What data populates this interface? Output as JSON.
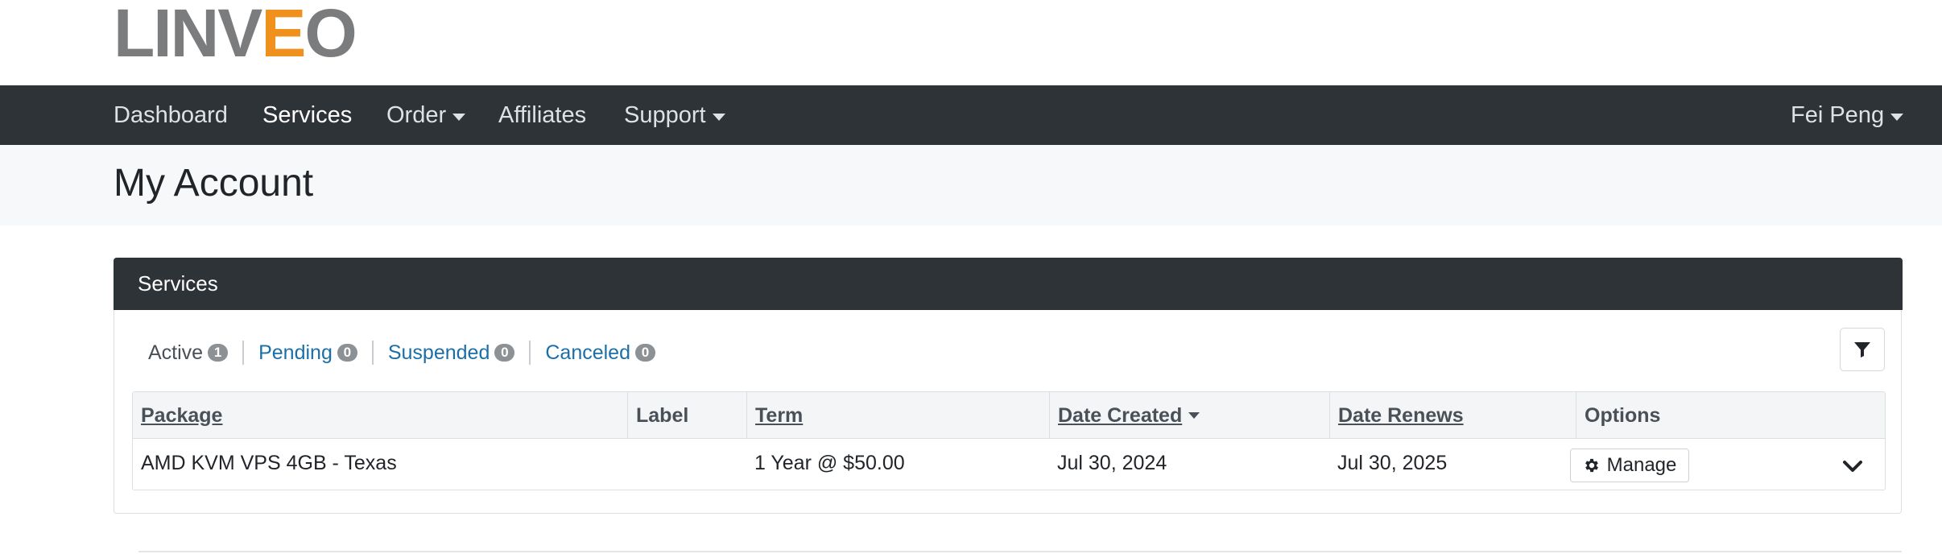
{
  "logo": {
    "text_a": "LINV",
    "text_e": "E",
    "text_o": "O"
  },
  "nav": {
    "items": [
      {
        "label": "Dashboard",
        "dropdown": false
      },
      {
        "label": "Services",
        "dropdown": false
      },
      {
        "label": "Order",
        "dropdown": true
      },
      {
        "label": "Affiliates",
        "dropdown": false
      },
      {
        "label": "Support",
        "dropdown": true
      }
    ],
    "user": "Fei Peng"
  },
  "page": {
    "title": "My Account"
  },
  "card": {
    "title": "Services",
    "filters": [
      {
        "label": "Active",
        "count": "1"
      },
      {
        "label": "Pending",
        "count": "0"
      },
      {
        "label": "Suspended",
        "count": "0"
      },
      {
        "label": "Canceled",
        "count": "0"
      }
    ],
    "table": {
      "columns": [
        "Package",
        "Label",
        "Term",
        "Date Created",
        "Date Renews",
        "Options"
      ],
      "rows": [
        {
          "package": "AMD KVM VPS 4GB - Texas",
          "label": "",
          "term": "1 Year @ $50.00",
          "date_created": "Jul 30, 2024",
          "date_renews": "Jul 30, 2025",
          "manage_label": "Manage"
        }
      ]
    }
  },
  "colors": {
    "navbar_bg": "#2e3338",
    "logo_gray": "#7b7c7e",
    "logo_orange": "#f0911d",
    "link_blue": "#1b6fa8",
    "badge_gray": "#8c9195"
  },
  "icons": {
    "filter": "funnel-icon",
    "manage": "gear-icon",
    "expand": "chevron-down-icon",
    "nav_dropdown": "caret-down-icon"
  }
}
